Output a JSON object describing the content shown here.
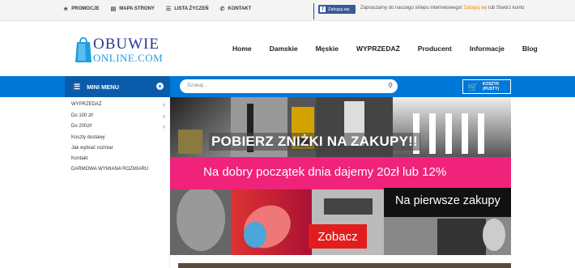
{
  "topbar": {
    "links": [
      {
        "icon": "star-icon",
        "label": "PROMOCJE"
      },
      {
        "icon": "map-icon",
        "label": "MAPA STRONY"
      },
      {
        "icon": "list-icon",
        "label": "LISTA ŻYCZEŃ"
      },
      {
        "icon": "phone-icon",
        "label": "KONTAKT"
      }
    ],
    "fb_button": "Zaloguj się",
    "welcome_prefix": "Zapraszamy do naszego sklepu internetowego!",
    "welcome_login": "Zaloguj się",
    "welcome_suffix": "lub Stwórz konto"
  },
  "logo": {
    "line1": "OBUWIE",
    "line2": "ONLINE.COM"
  },
  "nav": [
    "Home",
    "Damskie",
    "Męskie",
    "WYPRZEDAŻ",
    "Producent",
    "Informacje",
    "Blog"
  ],
  "bluebar": {
    "menu_label": "MINI MENU",
    "search_placeholder": "Szukaj...",
    "cart_line1": "KOSZYK",
    "cart_line2": "(PUSTY)"
  },
  "sidebar": {
    "items": [
      {
        "label": "WYPRZEDAŻ",
        "has_arrow": true
      },
      {
        "label": "Do 100 zł!",
        "has_arrow": true
      },
      {
        "label": "Do 200zł!",
        "has_arrow": true
      },
      {
        "label": "Koszty dostawy",
        "has_arrow": false
      },
      {
        "label": "Jak wybrać rozmiar",
        "has_arrow": false
      },
      {
        "label": "Kontakt",
        "has_arrow": false
      },
      {
        "label": "DARMOWA WYMIANA ROZMIARU",
        "has_arrow": false
      }
    ]
  },
  "banner": {
    "headline": "POBIERZ ZNIŻKI NA ZAKUPY!!",
    "pink_text": "Na dobry początek dnia dajemy 20zł lub 12%",
    "black_text": "Na pierwsze zakupy",
    "cta": "Zobacz"
  },
  "colors": {
    "blue": "#0078d7",
    "dark_blue": "#0a5cab",
    "pink": "#f0237a",
    "red": "#e31d1d",
    "fb": "#3b5998"
  }
}
